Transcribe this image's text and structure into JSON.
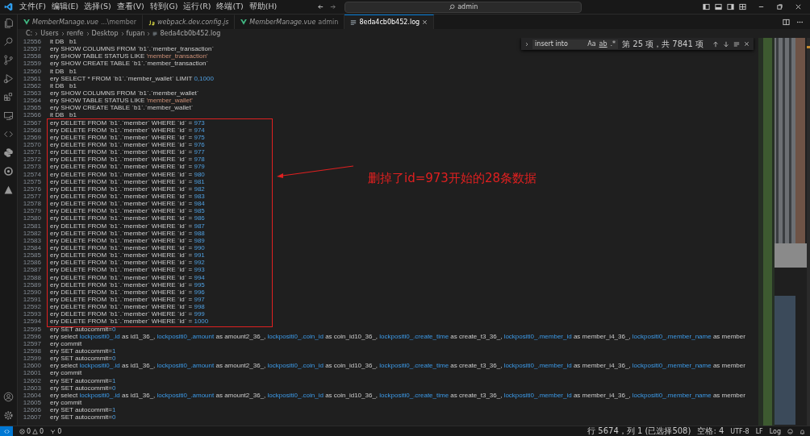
{
  "menu": [
    "文件(F)",
    "编辑(E)",
    "选择(S)",
    "查看(V)",
    "转到(G)",
    "运行(R)",
    "终端(T)",
    "帮助(H)"
  ],
  "command_center": {
    "value": "admin"
  },
  "tabs": [
    {
      "label": "MemberManage.vue",
      "description": "...\\member",
      "kind": "vue",
      "selected": false
    },
    {
      "label": "webpack.dev.config.js",
      "kind": "js",
      "selected": false
    },
    {
      "label": "MemberManage.vue",
      "description": "admin",
      "kind": "vue",
      "selected": false
    },
    {
      "label": "8eda4cb0b452.log",
      "kind": "log",
      "selected": true
    }
  ],
  "breadcrumb": [
    "C:",
    "Users",
    "renfe",
    "Desktop",
    "fupan",
    "8eda4cb0b452.log"
  ],
  "find": {
    "value": "insert into",
    "match_case": "Aa",
    "whole_word": "ab",
    "regex": ".*",
    "result": "第 25 项，共 7841 项"
  },
  "lines": [
    {
      "number": "12556",
      "segments": [
        {
          "kind": "plain",
          "text": "it DB   b1"
        }
      ]
    },
    {
      "number": "12557",
      "segments": [
        {
          "kind": "plain",
          "text": "ery SHOW COLUMNS FROM `b1`.`member_transaction`"
        }
      ]
    },
    {
      "number": "12558",
      "segments": [
        {
          "kind": "plain",
          "text": "ery SHOW TABLE STATUS LIKE "
        },
        {
          "kind": "string",
          "text": "'member_transaction'"
        }
      ]
    },
    {
      "number": "12559",
      "segments": [
        {
          "kind": "plain",
          "text": "ery SHOW CREATE TABLE `b1`.`member_transaction`"
        }
      ]
    },
    {
      "number": "12560",
      "segments": [
        {
          "kind": "plain",
          "text": "it DB   b1"
        }
      ]
    },
    {
      "number": "12561",
      "segments": [
        {
          "kind": "plain",
          "text": "ery SELECT * FROM `b1`.`member_wallet` LIMIT "
        },
        {
          "kind": "number",
          "text": "0,1000"
        }
      ]
    },
    {
      "number": "12562",
      "segments": [
        {
          "kind": "plain",
          "text": "it DB   b1"
        }
      ]
    },
    {
      "number": "12563",
      "segments": [
        {
          "kind": "plain",
          "text": "ery SHOW COLUMNS FROM `b1`.`member_wallet`"
        }
      ]
    },
    {
      "number": "12564",
      "segments": [
        {
          "kind": "plain",
          "text": "ery SHOW TABLE STATUS LIKE "
        },
        {
          "kind": "string",
          "text": "'member_wallet'"
        }
      ]
    },
    {
      "number": "12565",
      "segments": [
        {
          "kind": "plain",
          "text": "ery SHOW CREATE TABLE `b1`.`member_wallet`"
        }
      ]
    },
    {
      "number": "12566",
      "segments": [
        {
          "kind": "plain",
          "text": "it DB   b1"
        }
      ]
    },
    {
      "number": "12567",
      "segments": [
        {
          "kind": "plain",
          "text": "ery DELETE FROM `b1`.`member` WHERE `id` = "
        },
        {
          "kind": "number",
          "text": "973"
        }
      ]
    },
    {
      "number": "12568",
      "segments": [
        {
          "kind": "plain",
          "text": "ery DELETE FROM `b1`.`member` WHERE `id` = "
        },
        {
          "kind": "number",
          "text": "974"
        }
      ]
    },
    {
      "number": "12569",
      "segments": [
        {
          "kind": "plain",
          "text": "ery DELETE FROM `b1`.`member` WHERE `id` = "
        },
        {
          "kind": "number",
          "text": "975"
        }
      ]
    },
    {
      "number": "12570",
      "segments": [
        {
          "kind": "plain",
          "text": "ery DELETE FROM `b1`.`member` WHERE `id` = "
        },
        {
          "kind": "number",
          "text": "976"
        }
      ]
    },
    {
      "number": "12571",
      "segments": [
        {
          "kind": "plain",
          "text": "ery DELETE FROM `b1`.`member` WHERE `id` = "
        },
        {
          "kind": "number",
          "text": "977"
        }
      ]
    },
    {
      "number": "12572",
      "segments": [
        {
          "kind": "plain",
          "text": "ery DELETE FROM `b1`.`member` WHERE `id` = "
        },
        {
          "kind": "number",
          "text": "978"
        }
      ]
    },
    {
      "number": "12573",
      "segments": [
        {
          "kind": "plain",
          "text": "ery DELETE FROM `b1`.`member` WHERE `id` = "
        },
        {
          "kind": "number",
          "text": "979"
        }
      ]
    },
    {
      "number": "12574",
      "segments": [
        {
          "kind": "plain",
          "text": "ery DELETE FROM `b1`.`member` WHERE `id` = "
        },
        {
          "kind": "number",
          "text": "980"
        }
      ]
    },
    {
      "number": "12575",
      "segments": [
        {
          "kind": "plain",
          "text": "ery DELETE FROM `b1`.`member` WHERE `id` = "
        },
        {
          "kind": "number",
          "text": "981"
        }
      ]
    },
    {
      "number": "12576",
      "segments": [
        {
          "kind": "plain",
          "text": "ery DELETE FROM `b1`.`member` WHERE `id` = "
        },
        {
          "kind": "number",
          "text": "982"
        }
      ]
    },
    {
      "number": "12577",
      "segments": [
        {
          "kind": "plain",
          "text": "ery DELETE FROM `b1`.`member` WHERE `id` = "
        },
        {
          "kind": "number",
          "text": "983"
        }
      ]
    },
    {
      "number": "12578",
      "segments": [
        {
          "kind": "plain",
          "text": "ery DELETE FROM `b1`.`member` WHERE `id` = "
        },
        {
          "kind": "number",
          "text": "984"
        }
      ]
    },
    {
      "number": "12579",
      "segments": [
        {
          "kind": "plain",
          "text": "ery DELETE FROM `b1`.`member` WHERE `id` = "
        },
        {
          "kind": "number",
          "text": "985"
        }
      ]
    },
    {
      "number": "12580",
      "segments": [
        {
          "kind": "plain",
          "text": "ery DELETE FROM `b1`.`member` WHERE `id` = "
        },
        {
          "kind": "number",
          "text": "986"
        }
      ]
    },
    {
      "number": "12581",
      "segments": [
        {
          "kind": "plain",
          "text": "ery DELETE FROM `b1`.`member` WHERE `id` = "
        },
        {
          "kind": "number",
          "text": "987"
        }
      ]
    },
    {
      "number": "12582",
      "segments": [
        {
          "kind": "plain",
          "text": "ery DELETE FROM `b1`.`member` WHERE `id` = "
        },
        {
          "kind": "number",
          "text": "988"
        }
      ]
    },
    {
      "number": "12583",
      "segments": [
        {
          "kind": "plain",
          "text": "ery DELETE FROM `b1`.`member` WHERE `id` = "
        },
        {
          "kind": "number",
          "text": "989"
        }
      ]
    },
    {
      "number": "12584",
      "segments": [
        {
          "kind": "plain",
          "text": "ery DELETE FROM `b1`.`member` WHERE `id` = "
        },
        {
          "kind": "number",
          "text": "990"
        }
      ]
    },
    {
      "number": "12585",
      "segments": [
        {
          "kind": "plain",
          "text": "ery DELETE FROM `b1`.`member` WHERE `id` = "
        },
        {
          "kind": "number",
          "text": "991"
        }
      ]
    },
    {
      "number": "12586",
      "segments": [
        {
          "kind": "plain",
          "text": "ery DELETE FROM `b1`.`member` WHERE `id` = "
        },
        {
          "kind": "number",
          "text": "992"
        }
      ]
    },
    {
      "number": "12587",
      "segments": [
        {
          "kind": "plain",
          "text": "ery DELETE FROM `b1`.`member` WHERE `id` = "
        },
        {
          "kind": "number",
          "text": "993"
        }
      ]
    },
    {
      "number": "12588",
      "segments": [
        {
          "kind": "plain",
          "text": "ery DELETE FROM `b1`.`member` WHERE `id` = "
        },
        {
          "kind": "number",
          "text": "994"
        }
      ]
    },
    {
      "number": "12589",
      "segments": [
        {
          "kind": "plain",
          "text": "ery DELETE FROM `b1`.`member` WHERE `id` = "
        },
        {
          "kind": "number",
          "text": "995"
        }
      ]
    },
    {
      "number": "12590",
      "segments": [
        {
          "kind": "plain",
          "text": "ery DELETE FROM `b1`.`member` WHERE `id` = "
        },
        {
          "kind": "number",
          "text": "996"
        }
      ]
    },
    {
      "number": "12591",
      "segments": [
        {
          "kind": "plain",
          "text": "ery DELETE FROM `b1`.`member` WHERE `id` = "
        },
        {
          "kind": "number",
          "text": "997"
        }
      ]
    },
    {
      "number": "12592",
      "segments": [
        {
          "kind": "plain",
          "text": "ery DELETE FROM `b1`.`member` WHERE `id` = "
        },
        {
          "kind": "number",
          "text": "998"
        }
      ]
    },
    {
      "number": "12593",
      "segments": [
        {
          "kind": "plain",
          "text": "ery DELETE FROM `b1`.`member` WHERE `id` = "
        },
        {
          "kind": "number",
          "text": "999"
        }
      ]
    },
    {
      "number": "12594",
      "segments": [
        {
          "kind": "plain",
          "text": "ery DELETE FROM `b1`.`member` WHERE `id` = "
        },
        {
          "kind": "number",
          "text": "1000"
        }
      ]
    },
    {
      "number": "12595",
      "segments": [
        {
          "kind": "plain",
          "text": "ery SET autocommit="
        },
        {
          "kind": "number",
          "text": "0"
        }
      ]
    },
    {
      "number": "12596",
      "segments": [
        {
          "kind": "plain",
          "text": "ery select "
        },
        {
          "kind": "ident",
          "text": "lockpositi0_.id"
        },
        {
          "kind": "plain",
          "text": " as id1_36_, "
        },
        {
          "kind": "ident",
          "text": "lockpositi0_.amount"
        },
        {
          "kind": "plain",
          "text": " as amount2_36_, "
        },
        {
          "kind": "ident",
          "text": "lockpositi0_.coin_id"
        },
        {
          "kind": "plain",
          "text": " as coin_id10_36_, "
        },
        {
          "kind": "ident",
          "text": "lockpositi0_.create_time"
        },
        {
          "kind": "plain",
          "text": " as create_t3_36_, "
        },
        {
          "kind": "ident",
          "text": "lockpositi0_.member_id"
        },
        {
          "kind": "plain",
          "text": " as member_i4_36_, "
        },
        {
          "kind": "ident",
          "text": "lockpositi0_.member_name"
        },
        {
          "kind": "plain",
          "text": " as member"
        }
      ]
    },
    {
      "number": "12597",
      "segments": [
        {
          "kind": "plain",
          "text": "ery commit"
        }
      ]
    },
    {
      "number": "12598",
      "segments": [
        {
          "kind": "plain",
          "text": "ery SET autocommit="
        },
        {
          "kind": "number",
          "text": "1"
        }
      ]
    },
    {
      "number": "12599",
      "segments": [
        {
          "kind": "plain",
          "text": "ery SET autocommit="
        },
        {
          "kind": "number",
          "text": "0"
        }
      ]
    },
    {
      "number": "12600",
      "segments": [
        {
          "kind": "plain",
          "text": "ery select "
        },
        {
          "kind": "ident",
          "text": "lockpositi0_.id"
        },
        {
          "kind": "plain",
          "text": " as id1_36_, "
        },
        {
          "kind": "ident",
          "text": "lockpositi0_.amount"
        },
        {
          "kind": "plain",
          "text": " as amount2_36_, "
        },
        {
          "kind": "ident",
          "text": "lockpositi0_.coin_id"
        },
        {
          "kind": "plain",
          "text": " as coin_id10_36_, "
        },
        {
          "kind": "ident",
          "text": "lockpositi0_.create_time"
        },
        {
          "kind": "plain",
          "text": " as create_t3_36_, "
        },
        {
          "kind": "ident",
          "text": "lockpositi0_.member_id"
        },
        {
          "kind": "plain",
          "text": " as member_i4_36_, "
        },
        {
          "kind": "ident",
          "text": "lockpositi0_.member_name"
        },
        {
          "kind": "plain",
          "text": " as member"
        }
      ]
    },
    {
      "number": "12601",
      "segments": [
        {
          "kind": "plain",
          "text": "ery commit"
        }
      ]
    },
    {
      "number": "12602",
      "segments": [
        {
          "kind": "plain",
          "text": "ery SET autocommit="
        },
        {
          "kind": "number",
          "text": "1"
        }
      ]
    },
    {
      "number": "12603",
      "segments": [
        {
          "kind": "plain",
          "text": "ery SET autocommit="
        },
        {
          "kind": "number",
          "text": "0"
        }
      ]
    },
    {
      "number": "12604",
      "segments": [
        {
          "kind": "plain",
          "text": "ery select "
        },
        {
          "kind": "ident",
          "text": "lockpositi0_.id"
        },
        {
          "kind": "plain",
          "text": " as id1_36_, "
        },
        {
          "kind": "ident",
          "text": "lockpositi0_.amount"
        },
        {
          "kind": "plain",
          "text": " as amount2_36_, "
        },
        {
          "kind": "ident",
          "text": "lockpositi0_.coin_id"
        },
        {
          "kind": "plain",
          "text": " as coin_id10_36_, "
        },
        {
          "kind": "ident",
          "text": "lockpositi0_.create_time"
        },
        {
          "kind": "plain",
          "text": " as create_t3_36_, "
        },
        {
          "kind": "ident",
          "text": "lockpositi0_.member_id"
        },
        {
          "kind": "plain",
          "text": " as member_i4_36_, "
        },
        {
          "kind": "ident",
          "text": "lockpositi0_.member_name"
        },
        {
          "kind": "plain",
          "text": " as member"
        }
      ]
    },
    {
      "number": "12605",
      "segments": [
        {
          "kind": "plain",
          "text": "ery commit"
        }
      ]
    },
    {
      "number": "12606",
      "segments": [
        {
          "kind": "plain",
          "text": "ery SET autocommit="
        },
        {
          "kind": "number",
          "text": "1"
        }
      ]
    },
    {
      "number": "12607",
      "segments": [
        {
          "kind": "plain",
          "text": "ery SET autocommit="
        },
        {
          "kind": "number",
          "text": "0"
        }
      ]
    }
  ],
  "annotation": {
    "text": "删掉了id=973开始的28条数据"
  },
  "status_bar": {
    "errors": "0",
    "warnings": "0",
    "ports": "0",
    "position": "行 5674，列 1 (已选择508)",
    "indent": "空格: 4",
    "encoding": "UTF-8",
    "eol": "LF",
    "language": "Log"
  }
}
